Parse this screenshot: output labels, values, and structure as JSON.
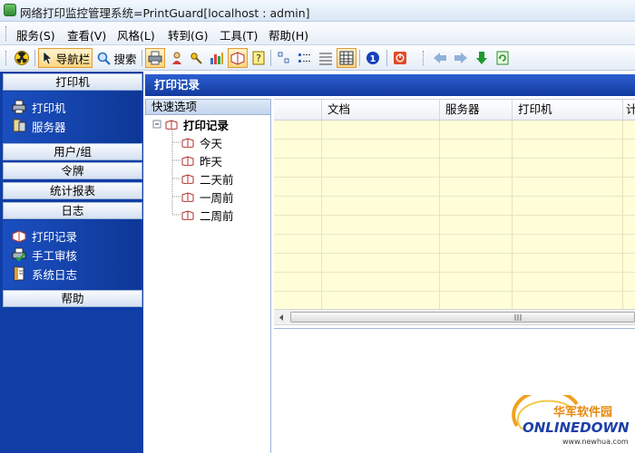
{
  "window": {
    "title": "网络打印监控管理系统=PrintGuard[localhost : admin]"
  },
  "menu": {
    "items": [
      "服务(S)",
      "查看(V)",
      "风格(L)",
      "转到(G)",
      "工具(T)",
      "帮助(H)"
    ]
  },
  "toolbar": {
    "navigator_label": "导航栏",
    "search_label": "搜索"
  },
  "sidebar": {
    "section_printer": "打印机",
    "printer_items": [
      "打印机",
      "服务器"
    ],
    "section_users": "用户/组",
    "section_token": "令牌",
    "section_reports": "统计报表",
    "section_log": "日志",
    "log_items": [
      "打印记录",
      "手工审核",
      "系统日志"
    ],
    "section_help": "帮助"
  },
  "main": {
    "title": "打印记录"
  },
  "quick_options": {
    "title": "快速选项",
    "root": "打印记录",
    "children": [
      "今天",
      "昨天",
      "二天前",
      "一周前",
      "二周前"
    ]
  },
  "grid": {
    "columns": [
      "文档",
      "服务器",
      "打印机",
      "计"
    ]
  },
  "watermark": {
    "brand_cn": "华军软件园",
    "brand_en": "ONLINEDOWN",
    "url": "www.newhua.com"
  },
  "colors": {
    "nav_bg": "#0f3ea6",
    "grid_bg": "#fffed8",
    "header_bg": "#1d4cc0"
  }
}
